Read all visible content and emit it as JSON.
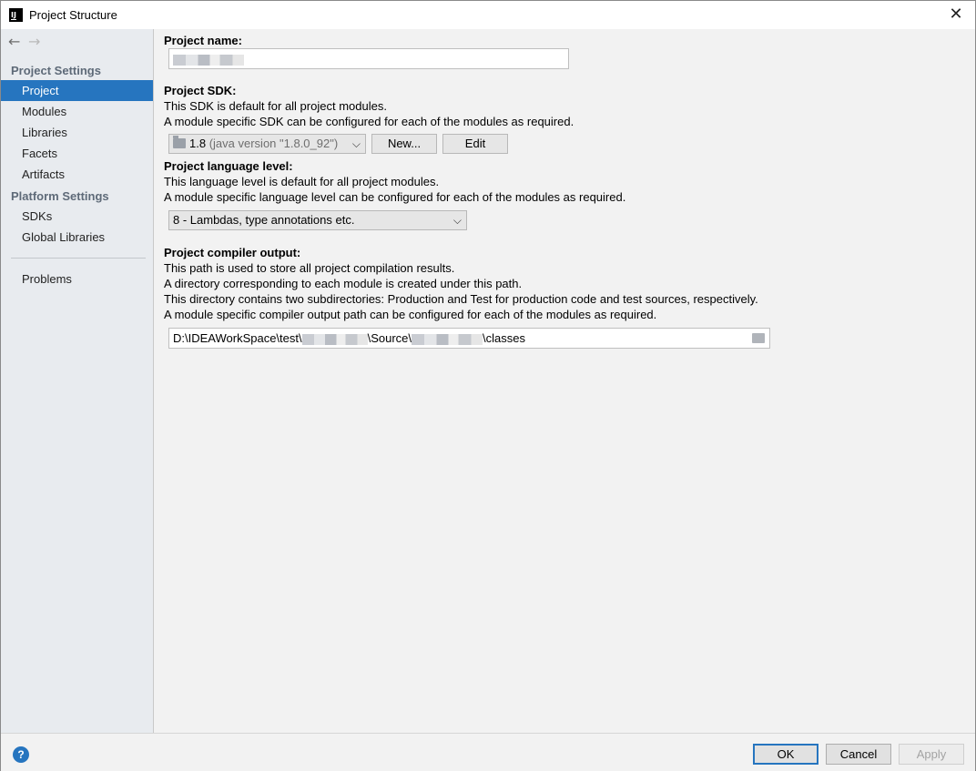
{
  "window": {
    "title": "Project Structure",
    "app_icon_text": "IJ"
  },
  "nav": {
    "back_icon": "←",
    "forward_icon": "→"
  },
  "sidebar": {
    "project_settings_heading": "Project Settings",
    "project_items": [
      {
        "label": "Project",
        "selected": true
      },
      {
        "label": "Modules",
        "selected": false
      },
      {
        "label": "Libraries",
        "selected": false
      },
      {
        "label": "Facets",
        "selected": false
      },
      {
        "label": "Artifacts",
        "selected": false
      }
    ],
    "platform_settings_heading": "Platform Settings",
    "platform_items": [
      {
        "label": "SDKs"
      },
      {
        "label": "Global Libraries"
      }
    ],
    "problems_label": "Problems"
  },
  "project": {
    "name_label": "Project name:",
    "name_value": "",
    "sdk_label": "Project SDK:",
    "sdk_desc1": "This SDK is default for all project modules.",
    "sdk_desc2": "A module specific SDK can be configured for each of the modules as required.",
    "sdk_selected": "1.8",
    "sdk_version": "(java version \"1.8.0_92\")",
    "new_button": "New...",
    "edit_button": "Edit",
    "lang_label": "Project language level:",
    "lang_desc1": "This language level is default for all project modules.",
    "lang_desc2": "A module specific language level can be configured for each of the modules as required.",
    "lang_selected": "8 - Lambdas, type annotations etc.",
    "output_label": "Project compiler output:",
    "output_desc1": "This path is used to store all project compilation results.",
    "output_desc2": "A directory corresponding to each module is created under this path.",
    "output_desc3": "This directory contains two subdirectories: Production and Test for production code and test sources, respectively.",
    "output_desc4": "A module specific compiler output path can be configured for each of the modules as required.",
    "output_path_part1": "D:\\IDEAWorkSpace\\test\\",
    "output_path_part2": "\\Source\\",
    "output_path_part3": "\\classes"
  },
  "footer": {
    "help_icon": "?",
    "ok": "OK",
    "cancel": "Cancel",
    "apply": "Apply"
  },
  "colors": {
    "accent": "#2675bf",
    "sidebar_bg": "#e8ebef",
    "panel_bg": "#f2f2f2"
  }
}
